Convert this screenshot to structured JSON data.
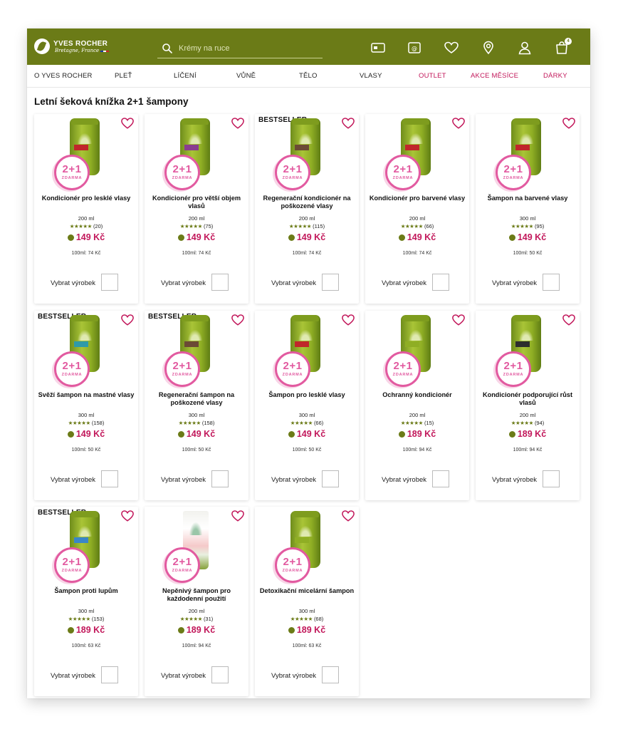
{
  "header": {
    "logo": {
      "main": "YVES ROCHER",
      "sub": "Bretagne, France"
    },
    "search": {
      "placeholder": "Krémy na ruce"
    },
    "cart_count": "4",
    "icons": [
      "loyalty-card-icon",
      "newsletter-icon",
      "heart-icon",
      "store-locator-icon",
      "account-icon",
      "cart-icon"
    ]
  },
  "nav": {
    "items": [
      {
        "label": "O YVES ROCHER",
        "highlight": false
      },
      {
        "label": "PLEŤ",
        "highlight": false
      },
      {
        "label": "LÍČENÍ",
        "highlight": false
      },
      {
        "label": "VŮNĚ",
        "highlight": false
      },
      {
        "label": "TĚLO",
        "highlight": false
      },
      {
        "label": "VLASY",
        "highlight": false
      },
      {
        "label": "OUTLET",
        "highlight": true
      },
      {
        "label": "AKCE MĚSÍCE",
        "highlight": true
      },
      {
        "label": "DÁRKY",
        "highlight": true
      }
    ]
  },
  "page_title": "Letní šeková knížka 2+1 šampony",
  "promo": {
    "main": "2+1",
    "sub": "ZDARMA"
  },
  "select_label": "Vybrat výrobek",
  "colors": {
    "brand_green": "#6b7b17",
    "price_pink": "#c2185b",
    "promo_pink": "#e25aa0"
  },
  "products": [
    {
      "name": "Kondicionér pro lesklé vlasy",
      "size": "200 ml",
      "stars": "★★★★★",
      "reviews": "(20)",
      "price": "149 Kč",
      "unit_price": "100ml: 74 Kč",
      "bestseller": "",
      "band": "#c0262b",
      "kind": "bottle"
    },
    {
      "name": "Kondicionér pro větší objem vlasů",
      "size": "200 ml",
      "stars": "★★★★★",
      "reviews": "(75)",
      "price": "149 Kč",
      "unit_price": "100ml: 74 Kč",
      "bestseller": "",
      "band": "#8a3d8f",
      "kind": "bottle"
    },
    {
      "name": "Regenerační kondicionér na poškozené vlasy",
      "size": "200 ml",
      "stars": "★★★★★",
      "reviews": "(115)",
      "price": "149 Kč",
      "unit_price": "100ml: 74 Kč",
      "bestseller": "BESTSELLER",
      "band": "#6b4a35",
      "kind": "bottle"
    },
    {
      "name": "Kondicionér pro barvené vlasy",
      "size": "200 ml",
      "stars": "★★★★★",
      "reviews": "(66)",
      "price": "149 Kč",
      "unit_price": "100ml: 74 Kč",
      "bestseller": "",
      "band": "#c0262b",
      "kind": "bottle"
    },
    {
      "name": "Šampon na barvené vlasy",
      "size": "300 ml",
      "stars": "★★★★★",
      "reviews": "(95)",
      "price": "149 Kč",
      "unit_price": "100ml: 50 Kč",
      "bestseller": "",
      "band": "#c0262b",
      "kind": "bottle"
    },
    {
      "name": "Svěží šampon na mastné vlasy",
      "size": "300 ml",
      "stars": "★★★★★",
      "reviews": "(158)",
      "price": "149 Kč",
      "unit_price": "100ml: 50 Kč",
      "bestseller": "BESTSELLER",
      "band": "#2f9aa8",
      "kind": "bottle"
    },
    {
      "name": "Regenerační šampon na poškozené vlasy",
      "size": "300 ml",
      "stars": "★★★★★",
      "reviews": "(158)",
      "price": "149 Kč",
      "unit_price": "100ml: 50 Kč",
      "bestseller": "BESTSELLER",
      "band": "#6b4a35",
      "kind": "bottle"
    },
    {
      "name": "Šampon pro lesklé vlasy",
      "size": "300 ml",
      "stars": "★★★★★",
      "reviews": "(66)",
      "price": "149 Kč",
      "unit_price": "100ml: 50 Kč",
      "bestseller": "",
      "band": "#c0262b",
      "kind": "bottle"
    },
    {
      "name": "Ochranný kondicionér",
      "size": "200 ml",
      "stars": "★★★★★",
      "reviews": "(15)",
      "price": "189 Kč",
      "unit_price": "100ml: 94 Kč",
      "bestseller": "",
      "band": "#8fae24",
      "kind": "bottle"
    },
    {
      "name": "Kondicionér podporující růst vlasů",
      "size": "200 ml",
      "stars": "★★★★★",
      "reviews": "(94)",
      "price": "189 Kč",
      "unit_price": "100ml: 94 Kč",
      "bestseller": "",
      "band": "#2d2d2d",
      "kind": "bottle"
    },
    {
      "name": "Šampon proti lupům",
      "size": "300 ml",
      "stars": "★★★★★",
      "reviews": "(153)",
      "price": "189 Kč",
      "unit_price": "100ml: 63 Kč",
      "bestseller": "BESTSELLER",
      "band": "#3a86c8",
      "kind": "bottle"
    },
    {
      "name": "Nepěnivý šampon pro každodenní použití",
      "size": "200 ml",
      "stars": "★★★★★",
      "reviews": "(31)",
      "price": "189 Kč",
      "unit_price": "100ml: 94 Kč",
      "bestseller": "",
      "band": "#f0b8b8",
      "kind": "tube"
    },
    {
      "name": "Detoxikační micelární šampon",
      "size": "300 ml",
      "stars": "★★★★★",
      "reviews": "(68)",
      "price": "189 Kč",
      "unit_price": "100ml: 63 Kč",
      "bestseller": "",
      "band": "#8fae24",
      "kind": "bottle"
    }
  ]
}
